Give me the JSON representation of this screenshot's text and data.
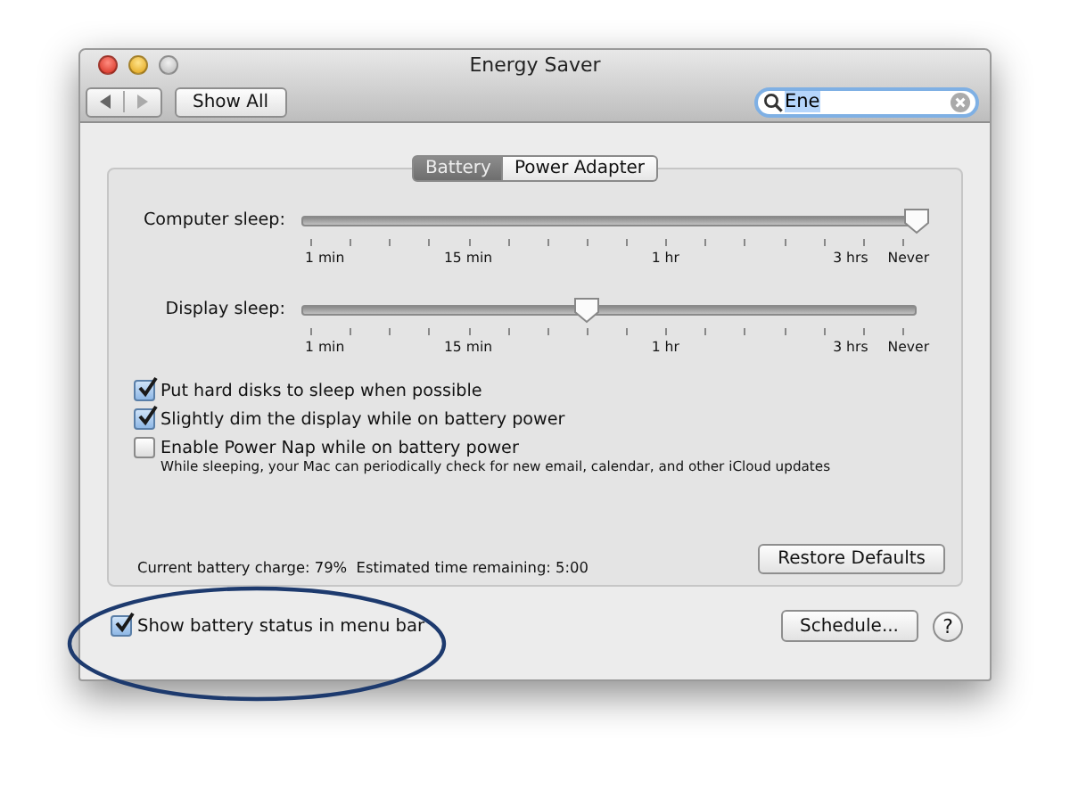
{
  "window": {
    "title": "Energy Saver"
  },
  "toolbar": {
    "show_all": "Show All",
    "search": {
      "value": "Ene"
    }
  },
  "tabs": [
    {
      "label": "Battery",
      "selected": true
    },
    {
      "label": "Power Adapter",
      "selected": false
    }
  ],
  "sliders": [
    {
      "label": "Computer sleep:",
      "level": 1.0,
      "ticks": [
        "1 min",
        "15 min",
        "1 hr",
        "3 hrs",
        "Never"
      ]
    },
    {
      "label": "Display sleep:",
      "level": 0.465,
      "ticks": [
        "1 min",
        "15 min",
        "1 hr",
        "3 hrs",
        "Never"
      ]
    }
  ],
  "options": [
    {
      "label": "Put hard disks to sleep when possible",
      "checked": true
    },
    {
      "label": "Slightly dim the display while on battery power",
      "checked": true
    },
    {
      "label": "Enable Power Nap while on battery power",
      "checked": false,
      "note": "While sleeping, your Mac can periodically check for new email, calendar, and other iCloud updates"
    }
  ],
  "status": "Current battery charge: 79%  Estimated time remaining: 5:00",
  "restore_button": "Restore Defaults",
  "menu_bar_option": {
    "label": "Show battery status in menu bar",
    "checked": true
  },
  "schedule_button": "Schedule...",
  "help_button": "?"
}
